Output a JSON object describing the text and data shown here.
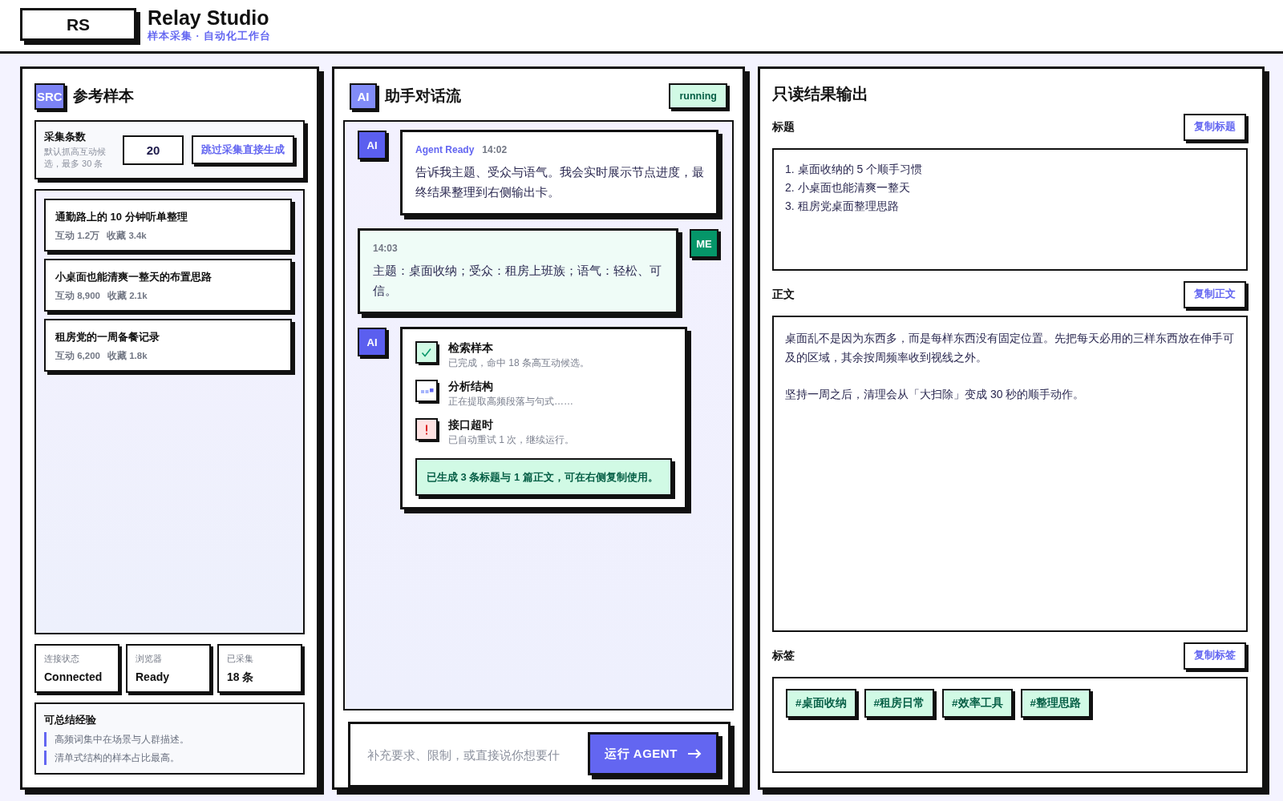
{
  "header": {
    "logo": "RS",
    "title": "Relay Studio",
    "subtitle": "样本采集 · 自动化工作台"
  },
  "source_panel": {
    "badge": "SRC",
    "title": "参考样本",
    "config": {
      "label": "采集条数",
      "hint": "默认抓高互动候选，最多 30 条",
      "count": "20",
      "skip_button": "跳过采集直接生成"
    },
    "samples": [
      {
        "title": "通勤路上的 10 分钟听单整理",
        "engagement": "互动 1.2万",
        "saves": "收藏 3.4k"
      },
      {
        "title": "小桌面也能清爽一整天的布置思路",
        "engagement": "互动 8,900",
        "saves": "收藏 2.1k"
      },
      {
        "title": "租房党的一周备餐记录",
        "engagement": "互动 6,200",
        "saves": "收藏 1.8k"
      }
    ],
    "stats": [
      {
        "label": "连接状态",
        "value": "Connected"
      },
      {
        "label": "浏览器",
        "value": "Ready"
      },
      {
        "label": "已采集",
        "value": "18 条"
      }
    ],
    "insights": {
      "title": "可总结经验",
      "items": [
        "高频词集中在场景与人群描述。",
        "清单式结构的样本占比最高。"
      ]
    }
  },
  "chat_panel": {
    "badge": "AI",
    "title": "助手对话流",
    "status": "running",
    "messages": [
      {
        "kind": "agent",
        "avatar": "AI",
        "sender": "Agent Ready",
        "time": "14:02",
        "text": "告诉我主题、受众与语气。我会实时展示节点进度，最终结果整理到右侧输出卡。"
      },
      {
        "kind": "user",
        "avatar": "ME",
        "time": "14:03",
        "text": "主题：桌面收纳；受众：租房上班族；语气：轻松、可信。"
      },
      {
        "kind": "steps",
        "avatar": "AI",
        "steps": [
          {
            "kind": "done",
            "title": "检索样本",
            "detail": "已完成，命中 18 条高互动候选。"
          },
          {
            "kind": "running",
            "title": "分析结构",
            "detail": "正在提取高频段落与句式……"
          },
          {
            "kind": "error",
            "title": "接口超时",
            "detail": "已自动重试 1 次，继续运行。"
          }
        ],
        "result": "已生成 3 条标题与 1 篇正文，可在右侧复制使用。"
      }
    ],
    "composer": {
      "placeholder": "补充要求、限制，或直接说你想要什",
      "button": "运行 AGENT"
    }
  },
  "output_panel": {
    "title": "只读结果输出",
    "sections": [
      {
        "kind": "list",
        "label": "标题",
        "copy_button": "复制标题",
        "lines": [
          "1. 桌面收纳的 5 个顺手习惯",
          "2. 小桌面也能清爽一整天",
          "3. 租房党桌面整理思路"
        ]
      },
      {
        "kind": "text",
        "label": "正文",
        "copy_button": "复制正文",
        "paragraphs": [
          "桌面乱不是因为东西多，而是每样东西没有固定位置。先把每天必用的三样东西放在伸手可及的区域，其余按周频率收到视线之外。",
          "坚持一周之后，清理会从「大扫除」变成 30 秒的顺手动作。"
        ]
      },
      {
        "kind": "tags",
        "label": "标签",
        "copy_button": "复制标签",
        "tags": [
          "#桌面收纳",
          "#租房日常",
          "#效率工具",
          "#整理思路"
        ]
      }
    ]
  }
}
